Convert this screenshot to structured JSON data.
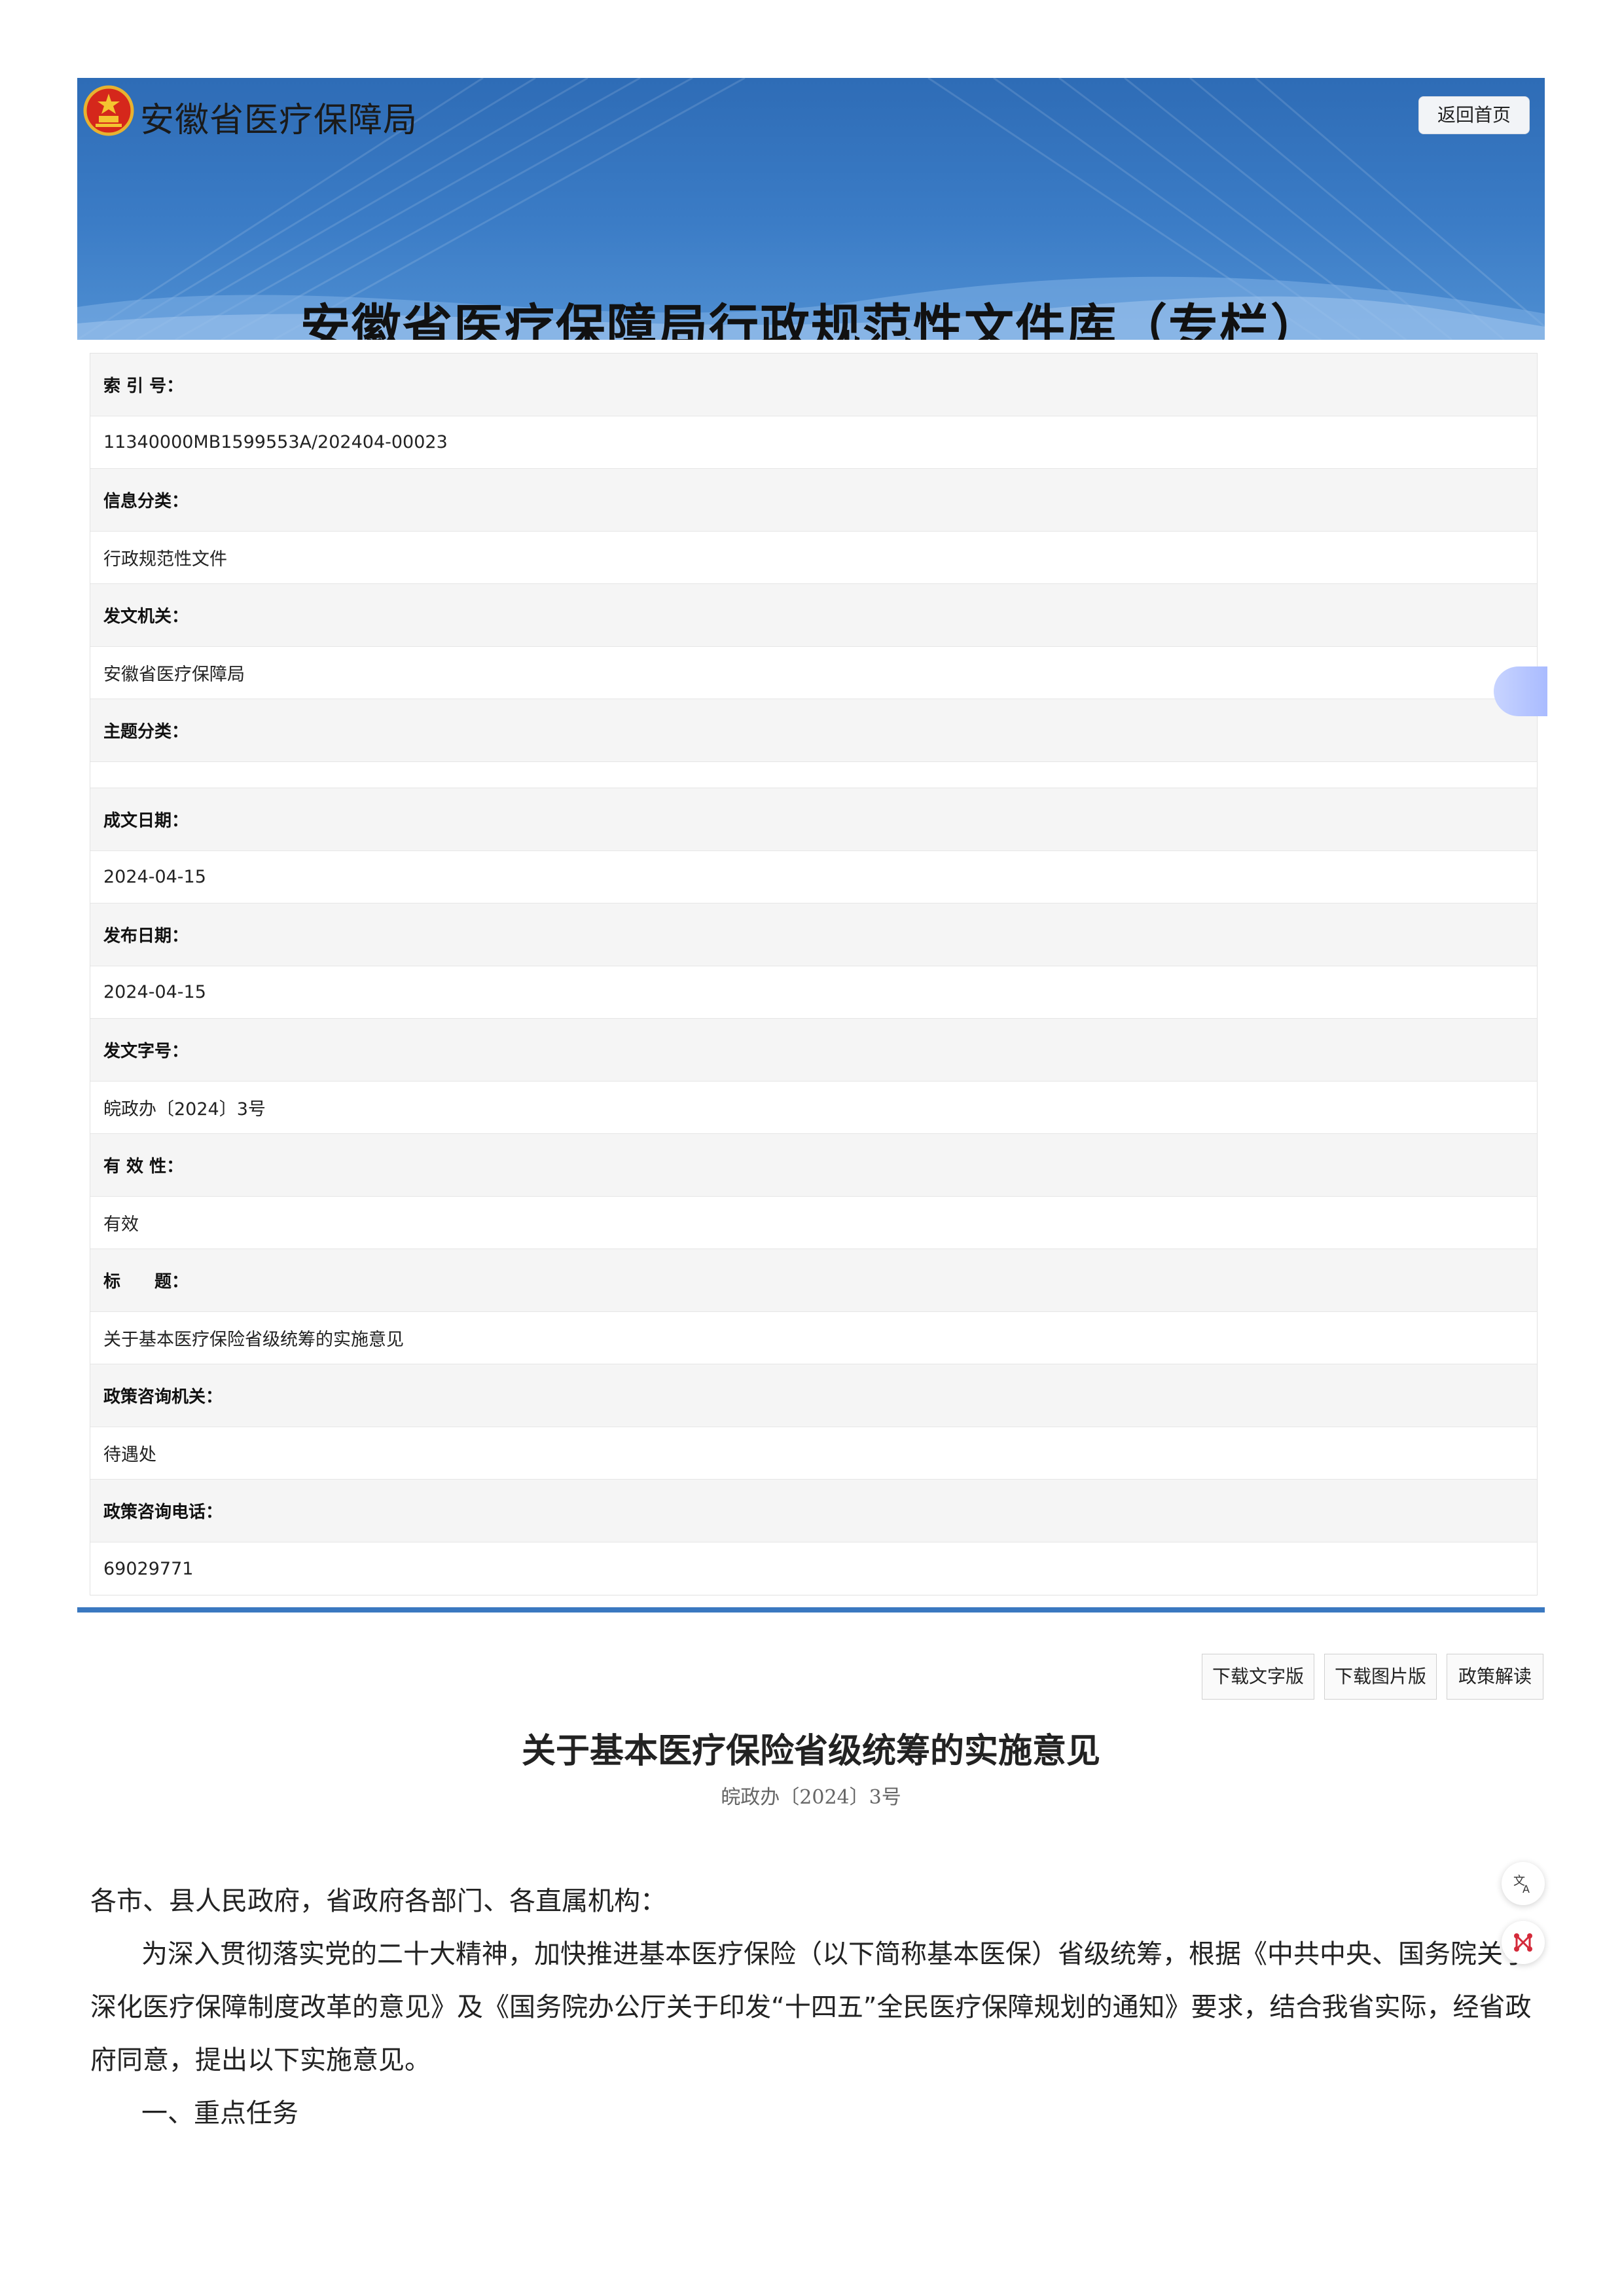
{
  "header": {
    "brand": "安徽省医疗保障局",
    "home_button": "返回首页",
    "title": "安徽省医疗保障局行政规范性文件库（专栏）"
  },
  "meta": [
    {
      "label": "索 引 号：",
      "value": "11340000MB1599553A/202404-00023"
    },
    {
      "label": "信息分类：",
      "value": "行政规范性文件"
    },
    {
      "label": "发文机关：",
      "value": "安徽省医疗保障局"
    },
    {
      "label": "主题分类：",
      "value": ""
    },
    {
      "label": "成文日期：",
      "value": "2024-04-15"
    },
    {
      "label": "发布日期：",
      "value": "2024-04-15"
    },
    {
      "label": "发文字号：",
      "value": "皖政办〔2024〕3号"
    },
    {
      "label": "有 效 性：",
      "value": "有效"
    },
    {
      "label": "标　　题：",
      "value": "关于基本医疗保险省级统筹的实施意见"
    },
    {
      "label": "政策咨询机关：",
      "value": "待遇处"
    },
    {
      "label": "政策咨询电话：",
      "value": "69029771"
    }
  ],
  "toolbar": {
    "download_text": "下载文字版",
    "download_image": "下载图片版",
    "interpretation": "政策解读"
  },
  "article": {
    "title": "关于基本医疗保险省级统筹的实施意见",
    "doc_number": "皖政办〔2024〕3号",
    "salutation": "各市、县人民政府，省政府各部门、各直属机构：",
    "paragraph1": "为深入贯彻落实党的二十大精神，加快推进基本医疗保险（以下简称基本医保）省级统筹，根据《中共中央、国务院关于深化医疗保障制度改革的意见》及《国务院办公厅关于印发“十四五”全民医疗保障规划的通知》要求，结合我省实际，经省政府同意，提出以下实施意见。",
    "section1": "一、重点任务"
  },
  "colors": {
    "banner": "#3b7cc6",
    "rule": "#3a78c0",
    "label_bg": "#f5f5f5"
  },
  "icons": [
    "national-emblem-icon",
    "translate-icon",
    "network-icon"
  ]
}
